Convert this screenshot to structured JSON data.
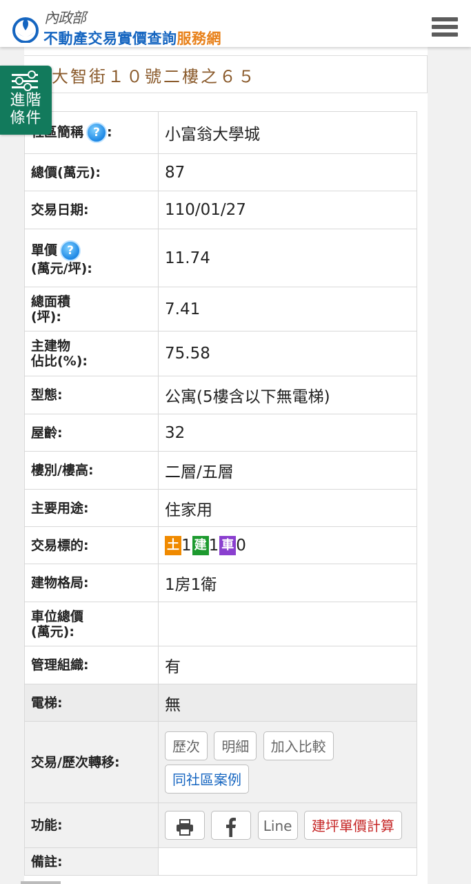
{
  "header": {
    "agency": "內政部",
    "title_main": "不動產交易實價查詢",
    "title_accent": "服務網",
    "menu_icon": "hamburger-menu-icon",
    "accent_color": "#1565c0",
    "accent_color_2": "#e8811a"
  },
  "address": "大智街１０號二樓之６５",
  "advanced_filter": {
    "label_line1": "進階",
    "label_line2": "條件",
    "icon": "sliders-icon",
    "color": "#127a5c"
  },
  "rows": [
    {
      "label": "社區簡稱",
      "value": "小富翁大學城"
    },
    {
      "label": "總價(萬元):",
      "value": "87"
    },
    {
      "label": "交易日期:",
      "value": "110/01/27"
    },
    {
      "label_line1": "單價",
      "label_line2": "(萬元/坪):",
      "value": "11.74"
    },
    {
      "label_line1": "總面積",
      "label_line2": "(坪):",
      "value": "7.41"
    },
    {
      "label_line1": "主建物",
      "label_line2": "佔比(%):",
      "value": "75.58"
    },
    {
      "label": "型態:",
      "value": "公寓(5樓含以下無電梯)"
    },
    {
      "label": "屋齡:",
      "value": "32"
    },
    {
      "label": "樓別/樓高:",
      "value": "二層/五層"
    },
    {
      "label": "主要用途:",
      "value": "住家用"
    },
    {
      "label": "交易標的:",
      "land_badge": "土",
      "land_count": "1",
      "building_badge": "建",
      "building_count": "1",
      "parking_badge": "車",
      "parking_count": "0"
    },
    {
      "label": "建物格局:",
      "value": "1房1衛"
    },
    {
      "label_line1": "車位總價",
      "label_line2": "(萬元):",
      "value": ""
    },
    {
      "label": "管理組織:",
      "value": "有"
    },
    {
      "label": "電梯:",
      "value": "無"
    },
    {
      "label": "交易/歷次轉移:"
    },
    {
      "label": "功能:"
    },
    {
      "label": "備註:",
      "value": ""
    }
  ],
  "community_label_suffix": ":",
  "question_icon_text": "?",
  "transfer_buttons": {
    "history": "歷次",
    "detail": "明細",
    "compare": "加入比較",
    "same_community": "同社區案例"
  },
  "function_buttons": {
    "print_icon": "printer-icon",
    "facebook_icon": "facebook-icon",
    "line": "Line",
    "calc": "建坪單價計算"
  }
}
